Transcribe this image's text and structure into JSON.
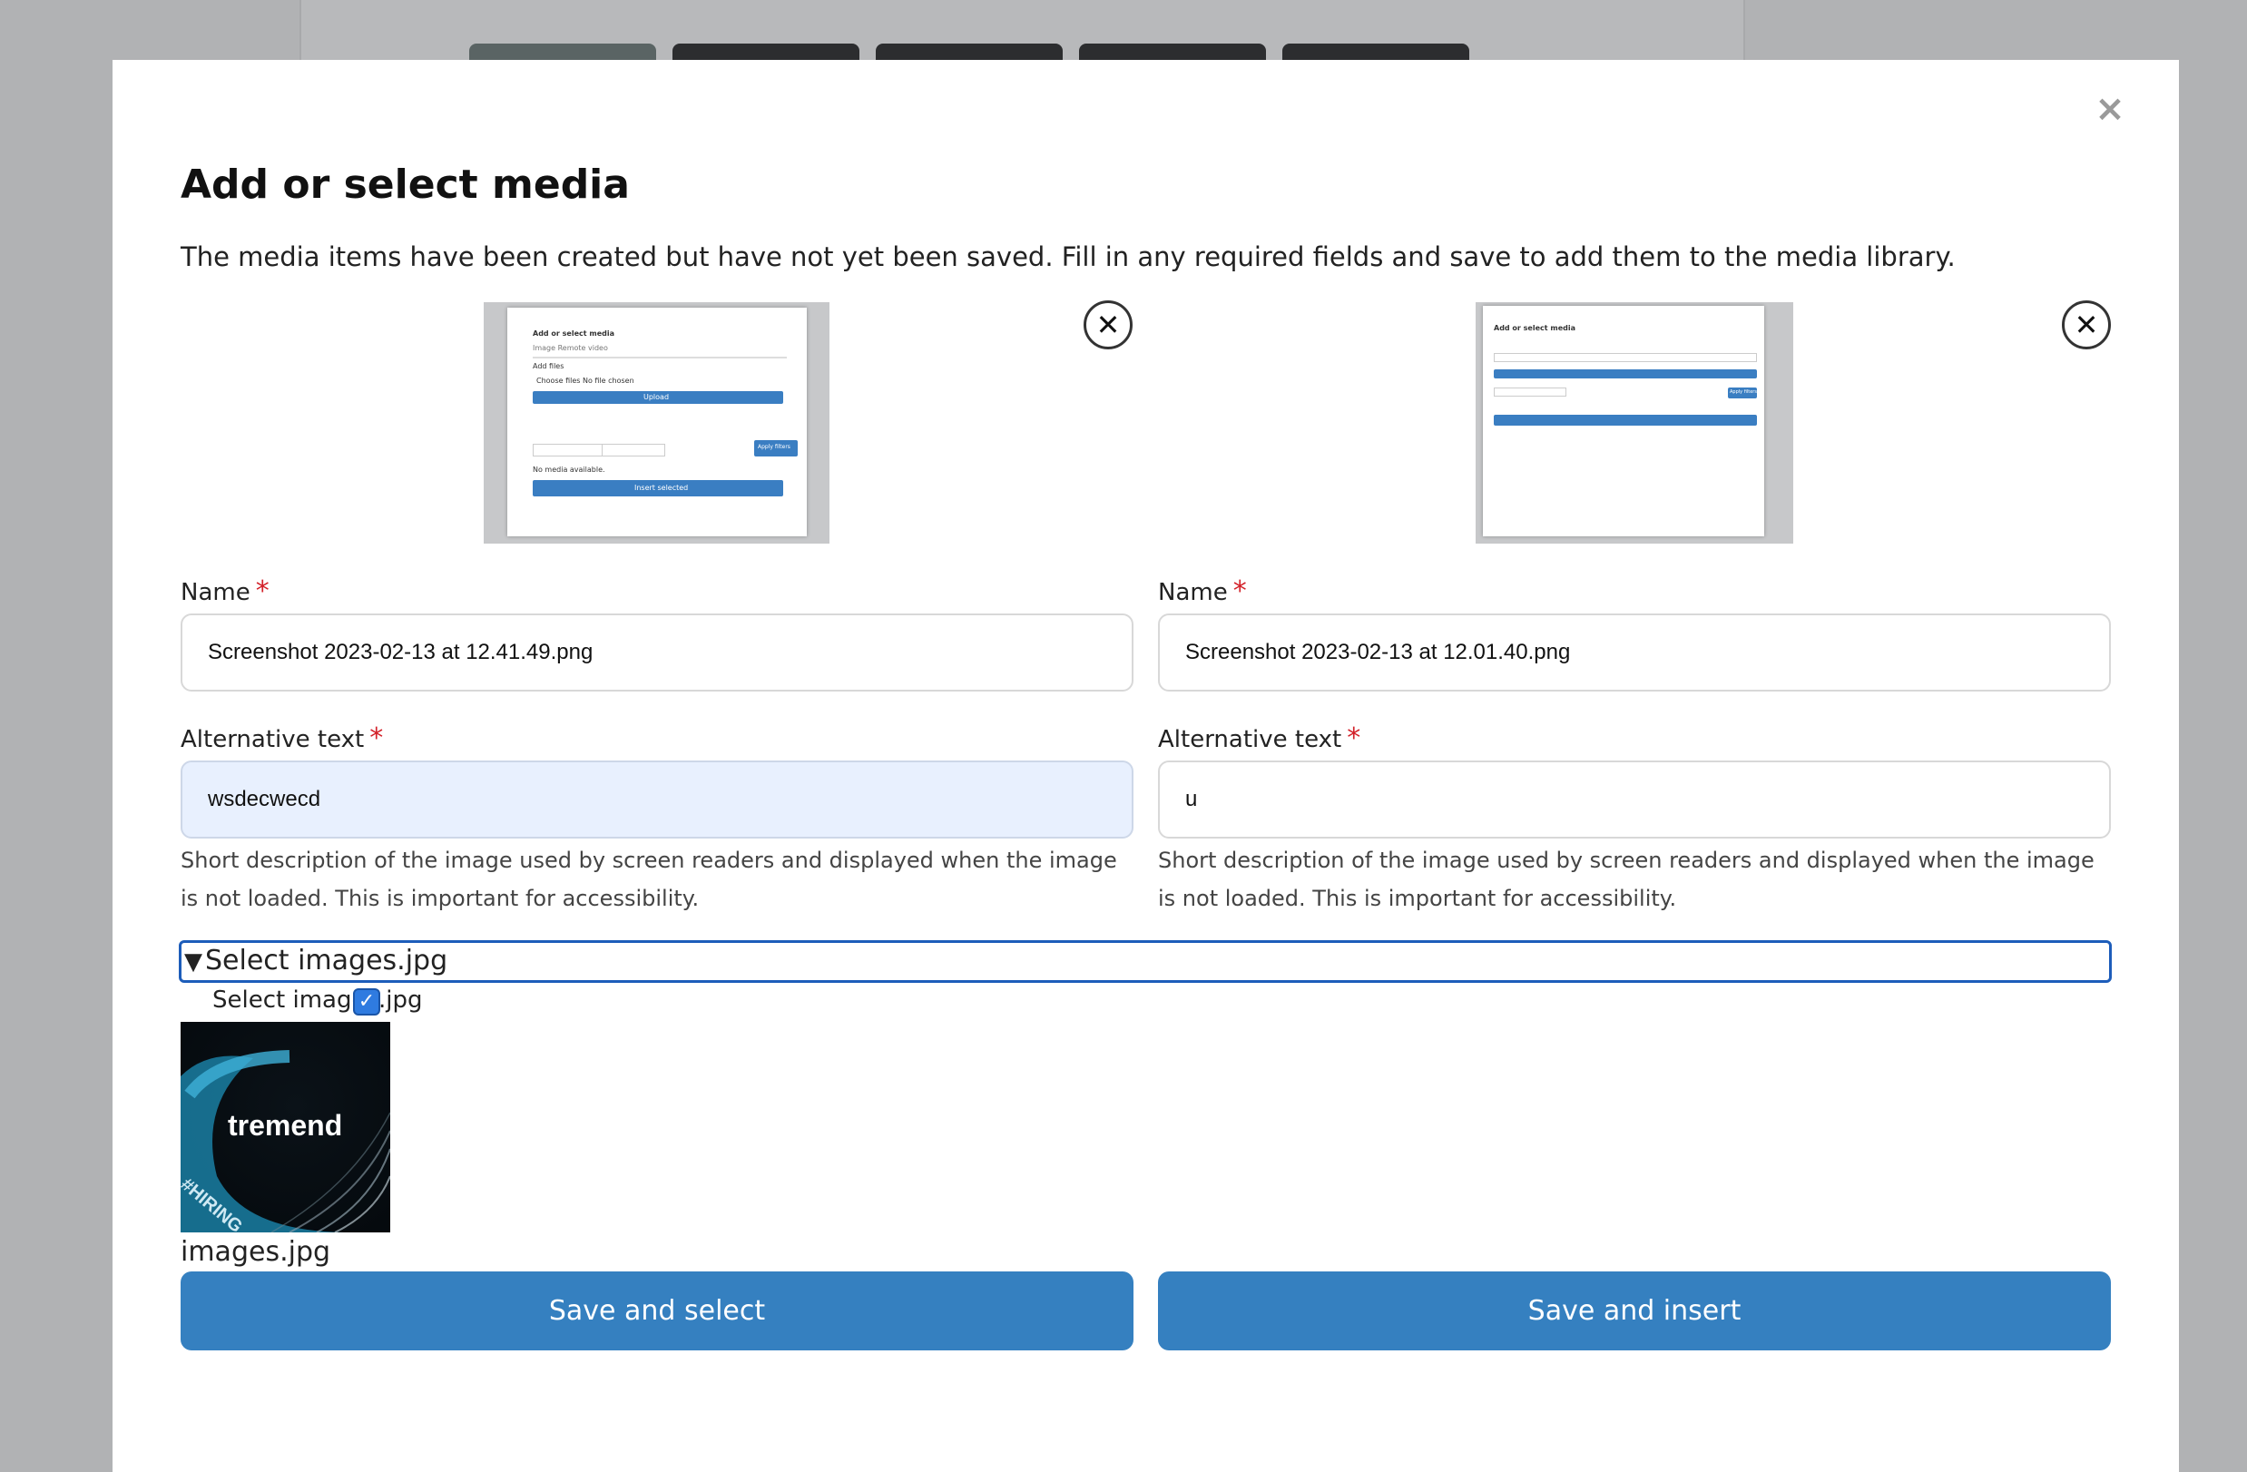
{
  "modal": {
    "title": "Add or select media",
    "close_label": "×",
    "intro": "The media items have been created but have not yet been saved. Fill in any required fields and save to add them to the media library."
  },
  "media_items": [
    {
      "remove_label": "✕",
      "thumb": {
        "title": "Add or select media",
        "tabs": "Image  Remote video",
        "add_files": "Add files",
        "choose": "Choose files   No file chosen",
        "upload": "Upload",
        "apply": "Apply filters",
        "none": "No media available.",
        "insert": "Insert selected"
      },
      "name_label": "Name",
      "name_required": "*",
      "name_value": "Screenshot 2023-02-13 at 12.41.49.png",
      "alt_label": "Alternative text",
      "alt_required": "*",
      "alt_value": "wsdecwecd",
      "help": "Short description of the image used by screen readers and displayed when the image is not loaded. This is important for accessibility."
    },
    {
      "remove_label": "✕",
      "thumb": {
        "title": "Add or select media",
        "apply": "Apply filters"
      },
      "name_label": "Name",
      "name_required": "*",
      "name_value": "Screenshot 2023-02-13 at 12.01.40.png",
      "alt_label": "Alternative text",
      "alt_required": "*",
      "alt_value": "u",
      "help": "Short description of the image used by screen readers and displayed when the image is not loaded. This is important for accessibility."
    }
  ],
  "selection": {
    "summary": "Select images.jpg",
    "arrow": "▼",
    "checkbox_label": "Select images.jpg",
    "checkbox_checked": true,
    "check_glyph": "✓",
    "image_text": "tremend",
    "image_tag": "#HIRING",
    "caption": "images.jpg"
  },
  "buttons": {
    "save_select": "Save and select",
    "save_insert": "Save and insert"
  },
  "colors": {
    "primary": "#3580c0",
    "required": "#d3222a",
    "focus": "#1d5dba",
    "autofill": "#e8f0fe"
  }
}
